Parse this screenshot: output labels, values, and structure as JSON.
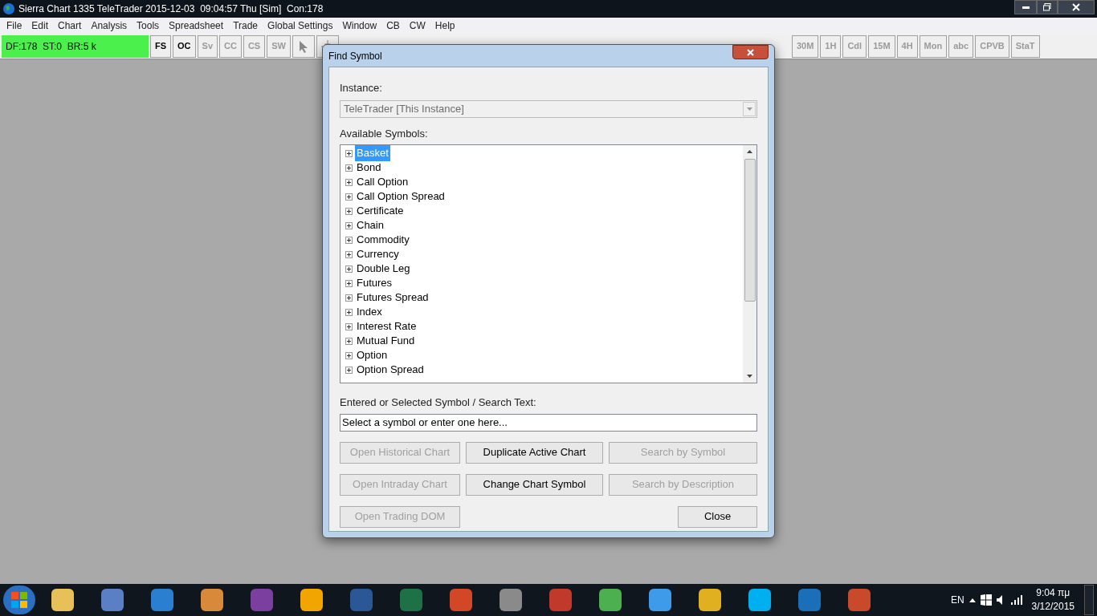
{
  "window": {
    "title": "Sierra Chart 1335 TeleTrader 2015-12-03  09:04:57 Thu [Sim]  Con:178"
  },
  "menu": [
    "File",
    "Edit",
    "Chart",
    "Analysis",
    "Tools",
    "Spreadsheet",
    "Trade",
    "Global Settings",
    "Window",
    "CB",
    "CW",
    "Help"
  ],
  "status_box": "DF:178  ST:0  BR:5 k",
  "toolbar_left": [
    {
      "label": "FS",
      "disabled": false
    },
    {
      "label": "OC",
      "disabled": false
    },
    {
      "label": "Sv",
      "disabled": true
    },
    {
      "label": "CC",
      "disabled": true
    },
    {
      "label": "CS",
      "disabled": true
    },
    {
      "label": "SW",
      "disabled": true
    }
  ],
  "toolbar_right": [
    {
      "label": "30M",
      "disabled": true
    },
    {
      "label": "1H",
      "disabled": true
    },
    {
      "label": "Cdl",
      "disabled": true
    },
    {
      "label": "15M",
      "disabled": true
    },
    {
      "label": "4H",
      "disabled": true
    },
    {
      "label": "Mon",
      "disabled": true
    },
    {
      "label": "abc",
      "disabled": true
    },
    {
      "label": "CPVB",
      "disabled": true
    },
    {
      "label": "StaT",
      "disabled": true
    }
  ],
  "dialog": {
    "title": "Find Symbol",
    "instance_label": "Instance:",
    "instance_value": "TeleTrader [This Instance]",
    "symbols_label": "Available Symbols:",
    "symbols": [
      {
        "label": "Basket",
        "selected": true
      },
      {
        "label": "Bond",
        "selected": false
      },
      {
        "label": "Call Option",
        "selected": false
      },
      {
        "label": "Call Option Spread",
        "selected": false
      },
      {
        "label": "Certificate",
        "selected": false
      },
      {
        "label": "Chain",
        "selected": false
      },
      {
        "label": "Commodity",
        "selected": false
      },
      {
        "label": "Currency",
        "selected": false
      },
      {
        "label": "Double Leg",
        "selected": false
      },
      {
        "label": "Futures",
        "selected": false
      },
      {
        "label": "Futures Spread",
        "selected": false
      },
      {
        "label": "Index",
        "selected": false
      },
      {
        "label": "Interest Rate",
        "selected": false
      },
      {
        "label": "Mutual Fund",
        "selected": false
      },
      {
        "label": "Option",
        "selected": false
      },
      {
        "label": "Option Spread",
        "selected": false
      }
    ],
    "search_label": "Entered or Selected Symbol / Search Text:",
    "search_value": "Select a symbol or enter one here...",
    "buttons": [
      {
        "label": "Open Historical Chart",
        "disabled": true
      },
      {
        "label": "Duplicate Active Chart",
        "disabled": false
      },
      {
        "label": "Search by Symbol",
        "disabled": true
      },
      {
        "label": "Open Intraday Chart",
        "disabled": true
      },
      {
        "label": "Change Chart Symbol",
        "disabled": false
      },
      {
        "label": "Search by Description",
        "disabled": true
      },
      {
        "label": "Open Trading DOM",
        "disabled": true
      }
    ],
    "close": "Close"
  },
  "taskbar": {
    "language": "EN",
    "time": "9:04 πμ",
    "date": "3/12/2015"
  }
}
